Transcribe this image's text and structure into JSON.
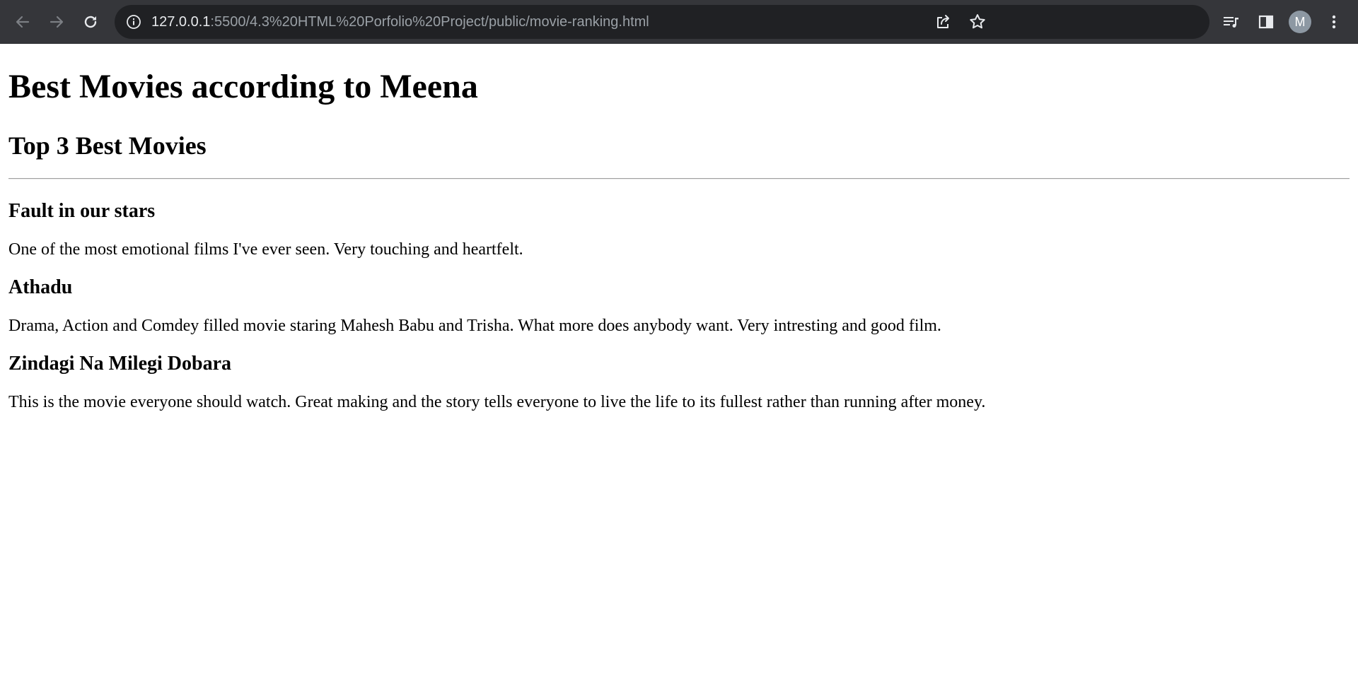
{
  "browser": {
    "url_host": "127.0.0.1",
    "url_rest": ":5500/4.3%20HTML%20Porfolio%20Project/public/movie-ranking.html",
    "profile_initial": "M",
    "icons": {
      "back": "back-arrow-icon",
      "forward": "forward-arrow-icon",
      "reload": "reload-icon",
      "info": "info-icon",
      "share": "share-icon",
      "bookmark": "star-icon",
      "media": "media-playlist-icon",
      "sidepanel": "side-panel-icon",
      "menu": "kebab-menu-icon"
    },
    "colors": {
      "toolbar": "#35363a",
      "omnibox": "#202124",
      "host_text": "#e8eaed",
      "path_text": "#9aa0a6",
      "avatar": "#8d98a3"
    }
  },
  "page": {
    "title": "Best Movies according to Meena",
    "subtitle": "Top 3 Best Movies",
    "movies": [
      {
        "name": "Fault in our stars",
        "review": "One of the most emotional films I've ever seen. Very touching and heartfelt."
      },
      {
        "name": "Athadu",
        "review": "Drama, Action and Comdey filled movie staring Mahesh Babu and Trisha. What more does anybody want. Very intresting and good film."
      },
      {
        "name": "Zindagi Na Milegi Dobara",
        "review": "This is the movie everyone should watch. Great making and the story tells everyone to live the life to its fullest rather than running after money."
      }
    ]
  }
}
